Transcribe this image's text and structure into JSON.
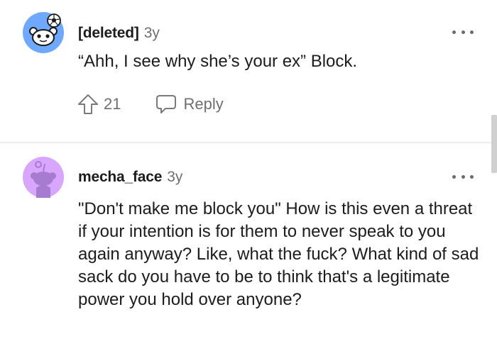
{
  "comments": [
    {
      "author": "[deleted]",
      "age": "3y",
      "body": "“Ahh, I see why she’s your ex” Block.",
      "votes": "21",
      "reply_label": "Reply",
      "avatar_icon": "snoo-soccer-avatar-icon",
      "avatar_color": "#6fa8ff"
    },
    {
      "author": "mecha_face",
      "age": "3y",
      "body": "\"Don't make me block you\" How is this even a threat if your intention is for them to never speak to you again anyway? Like, what the fuck? What kind of sad sack do you have to be to think that's a legitimate power you hold over anyone?",
      "avatar_icon": "snoo-purple-avatar-icon",
      "avatar_color": "#d9a6ff"
    }
  ],
  "icons": {
    "more": "more-options-icon",
    "upvote": "upvote-arrow-icon",
    "reply": "reply-bubble-icon"
  }
}
